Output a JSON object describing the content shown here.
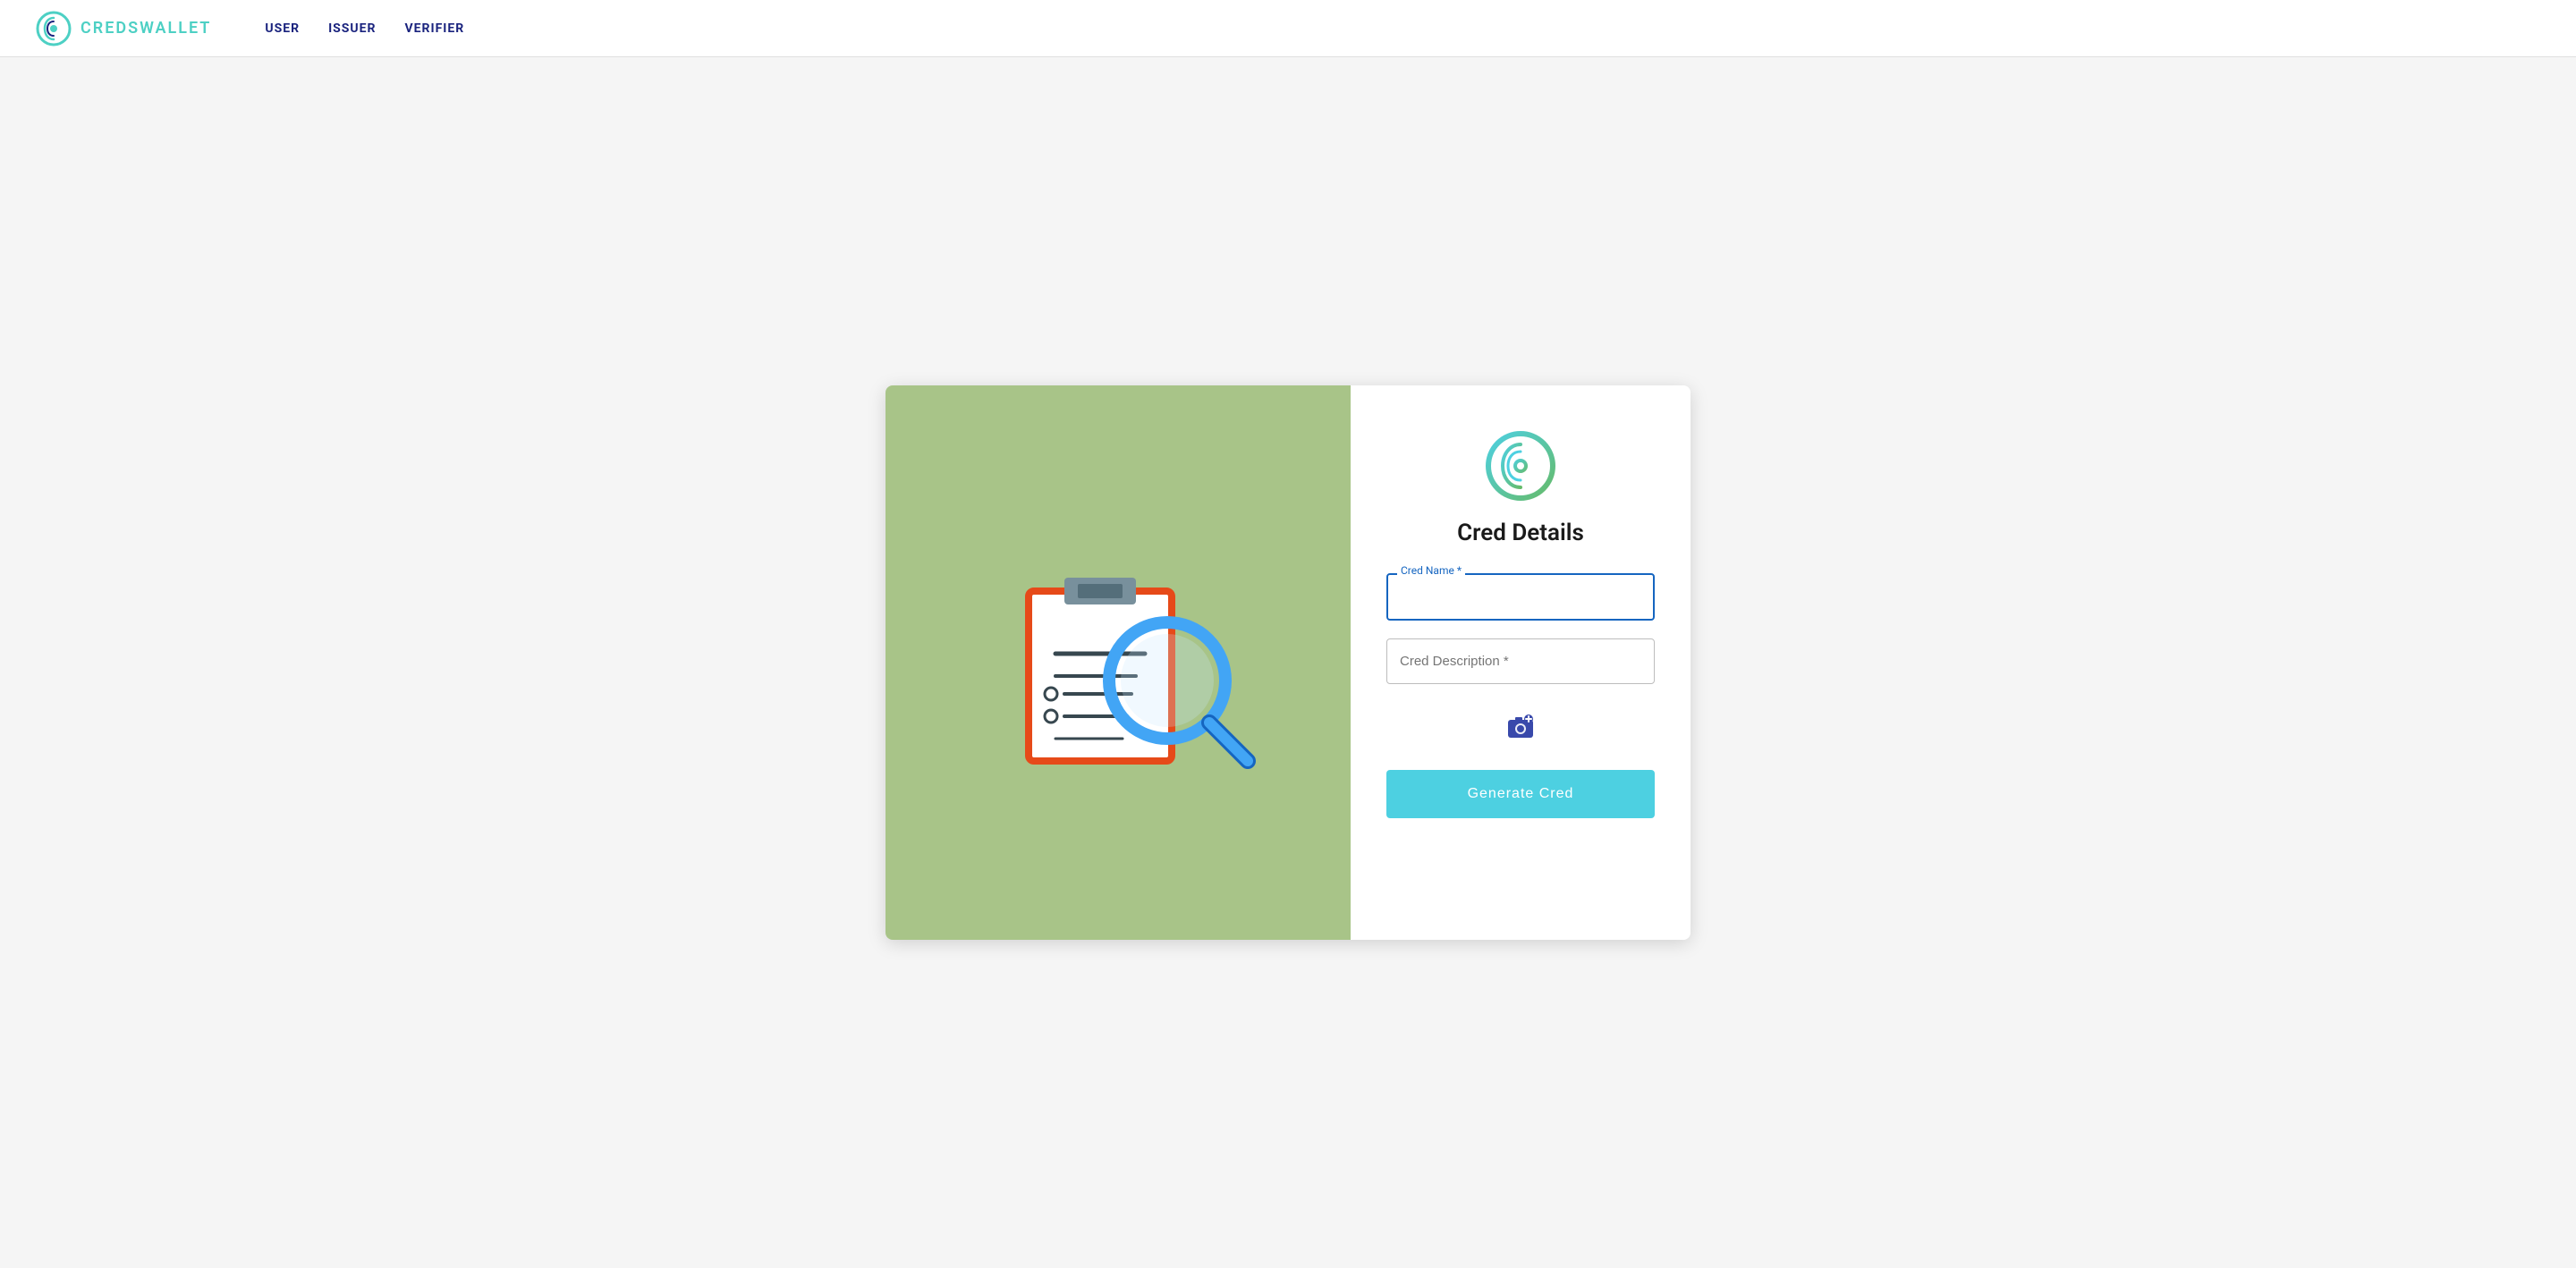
{
  "navbar": {
    "brand_name": "CREDSWALLET",
    "nav_items": [
      {
        "label": "USER",
        "active": true
      },
      {
        "label": "ISSUER",
        "active": false
      },
      {
        "label": "VERIFIER",
        "active": false
      }
    ]
  },
  "form": {
    "title": "Cred Details",
    "cred_name_label": "Cred Name *",
    "cred_name_placeholder": "",
    "cred_description_placeholder": "Cred Description *",
    "generate_button_label": "Generate Cred"
  },
  "icons": {
    "camera": "📷",
    "logo_alt": "CredWallet Logo"
  },
  "colors": {
    "accent": "#4dd0c4",
    "nav_color": "#1a237e",
    "left_bg": "#a8c488",
    "btn_bg": "#4dd0e1",
    "border_active": "#1565c0"
  }
}
